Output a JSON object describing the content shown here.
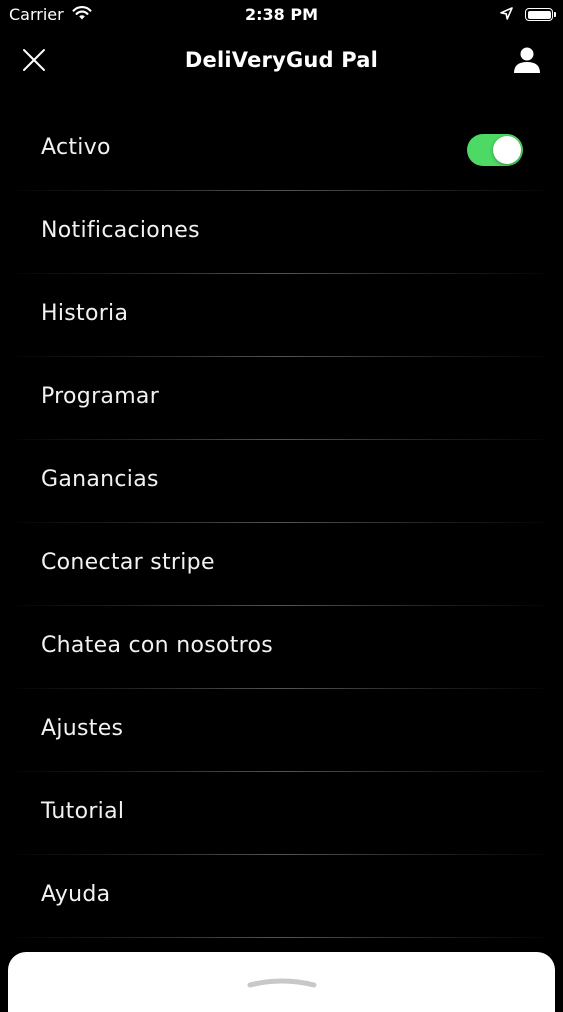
{
  "status_bar": {
    "carrier": "Carrier",
    "time": "2:38 PM",
    "icons": [
      "wifi-icon",
      "location-arrow-icon",
      "battery-icon"
    ]
  },
  "header": {
    "title": "DeliVeryGud Pal",
    "left_icon": "close-icon",
    "right_icon": "user-profile-icon"
  },
  "menu": {
    "items": [
      {
        "label": "Activo",
        "toggle": true,
        "toggle_on": true
      },
      {
        "label": "Notificaciones"
      },
      {
        "label": "Historia"
      },
      {
        "label": "Programar"
      },
      {
        "label": "Ganancias"
      },
      {
        "label": "Conectar stripe"
      },
      {
        "label": "Chatea con nosotros"
      },
      {
        "label": "Ajustes"
      },
      {
        "label": "Tutorial"
      },
      {
        "label": "Ayuda"
      }
    ]
  },
  "colors": {
    "background": "#000000",
    "toggle_on": "#4cd964",
    "text": "#f2f2f2",
    "sheet": "#ffffff"
  }
}
